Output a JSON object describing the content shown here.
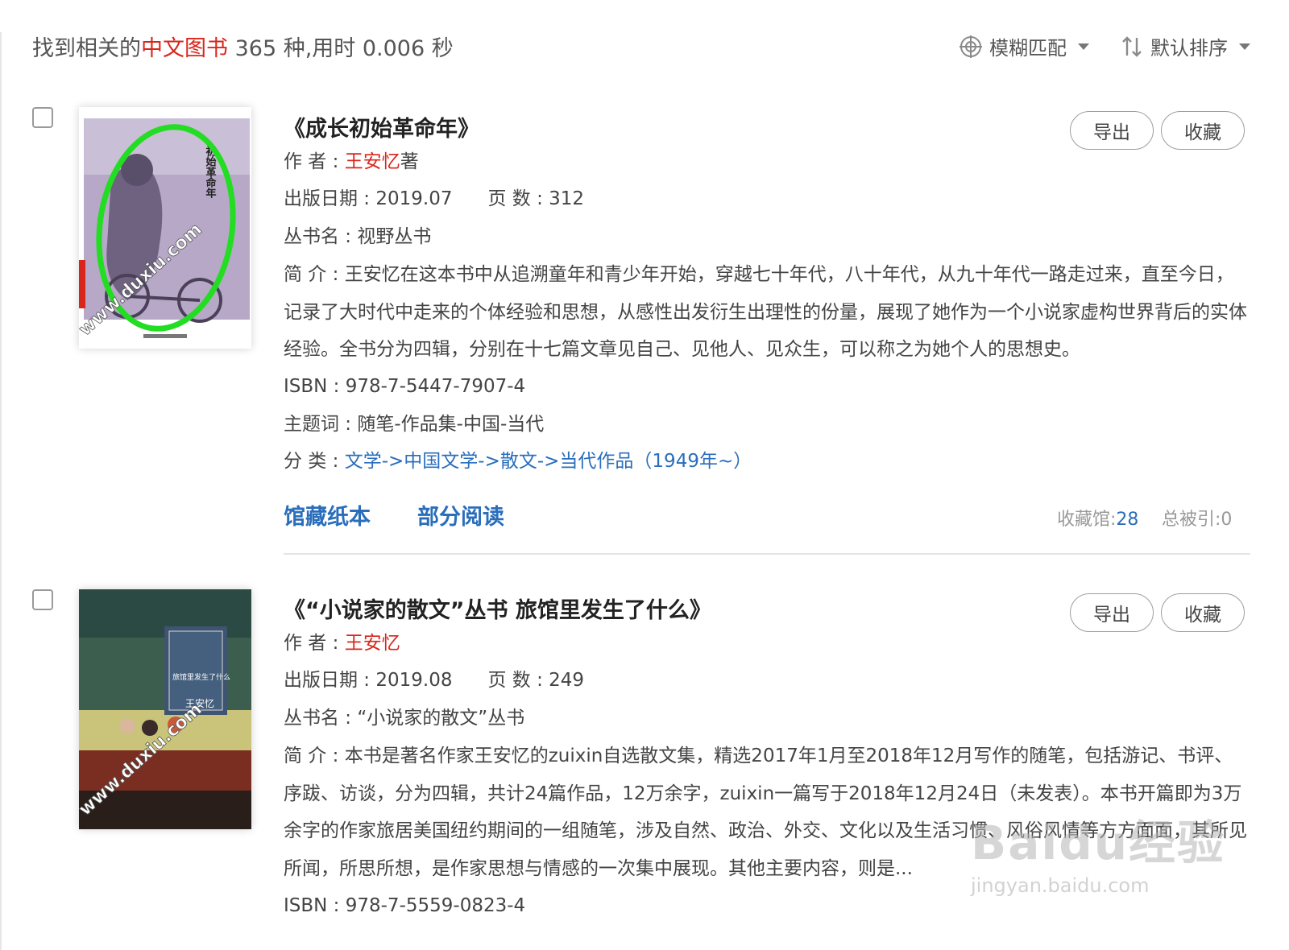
{
  "header": {
    "summary_prefix": "找到相关的",
    "summary_highlight": "中文图书",
    "summary_suffix": " 365 种,用时 0.006 秒",
    "fuzzy_label": "模糊匹配",
    "sort_label": "默认排序"
  },
  "results": [
    {
      "title": "《成长初始革命年》",
      "author_label": "作  者 : ",
      "author_name": "王安忆",
      "author_suffix": "著",
      "pubdate_label": "出版日期 : 2019.07",
      "pages_label": "页  数 : 312",
      "series_label": "丛书名 : 视野丛书",
      "intro_label": "简  介 : ",
      "intro_text": "王安忆在这本书中从追溯童年和青少年开始，穿越七十年代，八十年代，从九十年代一路走过来，直至今日，记录了大时代中走来的个体经验和思想，从感性出发衍生出理性的份量，展现了她作为一个小说家虚构世界背后的实体经验。全书分为四辑，分别在十七篇文章见自己、见他人、见众生，可以称之为她个人的思想史。",
      "isbn": "ISBN : 978-7-5447-7907-4",
      "subject": "主题词 : 随笔-作品集-中国-当代",
      "class_label": "分  类 : ",
      "class_1": "文学",
      "class_2": "中国文学",
      "class_3": "散文",
      "class_4": "当代作品（1949年~）",
      "arrow": "->",
      "link_holdings": "馆藏纸本",
      "link_read": "部分阅读",
      "stat_libs_label": "收藏馆:",
      "stat_libs_value": "28",
      "stat_cited": "总被引:0",
      "btn_export": "导出",
      "btn_fav": "收藏",
      "cover_text": "初始革命年",
      "cover_watermark": "www.duxiu.com"
    },
    {
      "title": "《“小说家的散文”丛书 旅馆里发生了什么》",
      "author_label": "作  者 : ",
      "author_name": "王安忆",
      "pubdate_label": "出版日期 : 2019.08",
      "pages_label": "页  数 : 249",
      "series_label": "丛书名 : “小说家的散文”丛书",
      "intro_label": "简  介 : ",
      "intro_text": "本书是著名作家王安忆的zuixin自选散文集，精选2017年1月至2018年12月写作的随笔，包括游记、书评、序跋、访谈，分为四辑，共计24篇作品，12万余字，zuixin一篇写于2018年12月24日（未发表）。本书开篇即为3万余字的作家旅居美国纽约期间的一组随笔，涉及自然、政治、外交、文化以及生活习惯、风俗风情等方方面面，其所见所闻，所思所想，是作家思想与情感的一次集中展现。其他主要内容，则是...",
      "isbn": "ISBN : 978-7-5559-0823-4",
      "btn_export": "导出",
      "btn_fav": "收藏",
      "cover_text": "旅馆里发生了什么",
      "cover_author": "王安忆",
      "cover_watermark": "www.duxiu.com"
    }
  ],
  "watermark": {
    "mark": "Baidu经验",
    "url": "jingyan.baidu.com"
  },
  "colors": {
    "highlight_red": "#d9261c",
    "link_blue": "#2a6ebb",
    "annotation_green": "#22dd22"
  }
}
